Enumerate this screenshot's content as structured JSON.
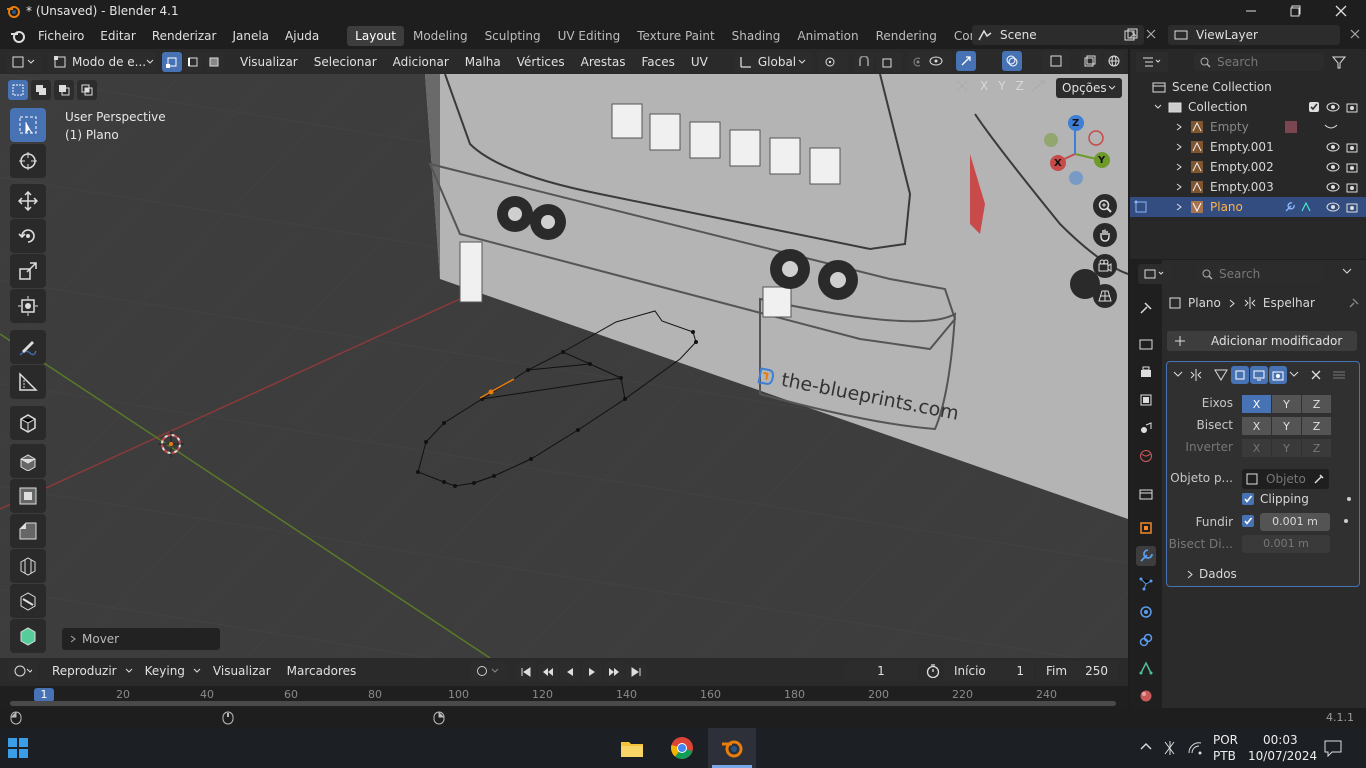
{
  "window": {
    "title": "* (Unsaved) - Blender 4.1"
  },
  "menus": [
    "Ficheiro",
    "Editar",
    "Renderizar",
    "Janela",
    "Ajuda"
  ],
  "workspaces": [
    "Layout",
    "Modeling",
    "Sculpting",
    "UV Editing",
    "Texture Paint",
    "Shading",
    "Animation",
    "Rendering",
    "Compositing"
  ],
  "scene": {
    "name": "Scene",
    "view_layer": "ViewLayer"
  },
  "header": {
    "mode": "Modo de e...",
    "menus": [
      "Visualizar",
      "Selecionar",
      "Adicionar",
      "Malha",
      "Vértices",
      "Arestas",
      "Faces",
      "UV"
    ],
    "orientation": "Global",
    "axes": [
      "X",
      "Y",
      "Z"
    ],
    "options": "Opções"
  },
  "viewport": {
    "perspective": "User Perspective",
    "object": "(1) Plano",
    "operator_panel": "Mover",
    "watermark": "the-blueprints.com",
    "gizmo": {
      "x": "X",
      "y": "Y",
      "z": "Z"
    }
  },
  "timeline": {
    "menus": [
      "Reproduzir",
      "Keying",
      "Visualizar",
      "Marcadores"
    ],
    "current_frame": "1",
    "start_label": "Início",
    "start": "1",
    "end_label": "Fim",
    "end": "250",
    "ruler": [
      "1",
      "20",
      "40",
      "60",
      "80",
      "100",
      "120",
      "140",
      "160",
      "180",
      "200",
      "220",
      "240"
    ]
  },
  "outliner": {
    "search_placeholder": "Search",
    "root": "Scene Collection",
    "collection": "Collection",
    "items": [
      "Empty",
      "Empty.001",
      "Empty.002",
      "Empty.003",
      "Plano"
    ]
  },
  "properties": {
    "search_placeholder": "Search",
    "breadcrumb_object": "Plano",
    "breadcrumb_modifier": "Espelhar",
    "add_modifier": "Adicionar modificador",
    "axes_label": "Eixos",
    "bisect_label": "Bisect",
    "invert_label": "Inverter",
    "mirror_object_label": "Objeto p...",
    "mirror_object_placeholder": "Objeto",
    "clipping_label": "Clipping",
    "merge_label": "Fundir",
    "merge_value": "0.001 m",
    "bisect_distance_label": "Bisect Di...",
    "bisect_distance_value": "0.001 m",
    "data_label": "Dados",
    "x": "X",
    "y": "Y",
    "z": "Z"
  },
  "status": {
    "version": "4.1.1"
  },
  "taskbar": {
    "language": "POR",
    "layout": "PTB",
    "time": "00:03",
    "date": "10/07/2024"
  },
  "colors": {
    "accent": "#4772b3",
    "header": "#2a2a2a",
    "viewport": "#3d3d3d",
    "x_axis": "#c84a4a",
    "y_axis": "#6e9a2a",
    "selection": "#334d80"
  }
}
